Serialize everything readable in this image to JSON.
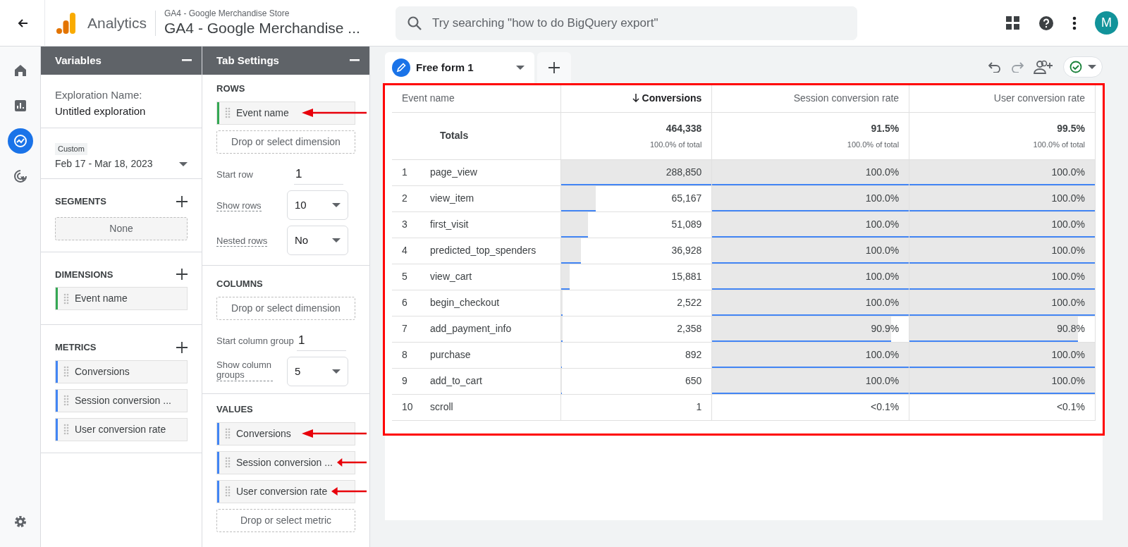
{
  "header": {
    "app_name": "Analytics",
    "account": "GA4 - Google Merchandise Store",
    "property": "GA4 - Google Merchandise ...",
    "search": {
      "placeholder": "Try searching \"how to do BigQuery export\""
    },
    "avatar": "M"
  },
  "nav_rail": [
    {
      "kind": "home",
      "selected": false
    },
    {
      "kind": "reports",
      "selected": false
    },
    {
      "kind": "explore",
      "selected": true
    },
    {
      "kind": "advertising",
      "selected": false
    },
    {
      "kind": "settings",
      "selected": false
    }
  ],
  "variables": {
    "title": "Variables",
    "exploration_label": "Exploration Name:",
    "exploration_name": "Untitled exploration",
    "date_tag": "Custom",
    "date_range": "Feb 17 - Mar 18, 2023",
    "segments": {
      "title": "SEGMENTS",
      "empty": "None"
    },
    "dimensions": {
      "title": "DIMENSIONS",
      "items": [
        {
          "label": "Event name",
          "color": "#34a853"
        }
      ]
    },
    "metrics": {
      "title": "METRICS",
      "items": [
        {
          "label": "Conversions",
          "color": "#4285f4"
        },
        {
          "label": "Session conversion ...",
          "color": "#4285f4"
        },
        {
          "label": "User conversion rate",
          "color": "#4285f4"
        }
      ]
    }
  },
  "tab_settings": {
    "title": "Tab Settings",
    "rows": {
      "title": "ROWS",
      "items": [
        {
          "label": "Event name",
          "color": "#34a853",
          "annotated": true
        }
      ],
      "drop": "Drop or select dimension",
      "start_row_label": "Start row",
      "start_row": "1",
      "show_rows_label": "Show rows",
      "show_rows": "10",
      "nested_rows_label": "Nested rows",
      "nested_rows": "No"
    },
    "columns": {
      "title": "COLUMNS",
      "drop": "Drop or select dimension",
      "start_label": "Start column group",
      "start": "1",
      "show_label": "Show column groups",
      "show": "5"
    },
    "values": {
      "title": "VALUES",
      "items": [
        {
          "label": "Conversions",
          "color": "#4285f4",
          "annotated": true
        },
        {
          "label": "Session conversion ...",
          "color": "#4285f4",
          "annotated": true
        },
        {
          "label": "User conversion rate",
          "color": "#4285f4",
          "annotated": true
        }
      ],
      "drop": "Drop or select metric"
    }
  },
  "tabs": [
    {
      "label": "Free form 1",
      "selected": true
    }
  ],
  "table": {
    "highlighted": true,
    "columns": [
      {
        "label": "Event name",
        "sorted": false
      },
      {
        "label": "Conversions",
        "sorted": true
      },
      {
        "label": "Session conversion rate",
        "sorted": false
      },
      {
        "label": "User conversion rate",
        "sorted": false
      }
    ],
    "totals": [
      {
        "value": "Totals"
      },
      {
        "value": "464,338",
        "share": "100.0% of total"
      },
      {
        "value": "91.5%",
        "share": "100.0% of total"
      },
      {
        "value": "99.5%",
        "share": "100.0% of total"
      }
    ],
    "rows": [
      {
        "cells": [
          {
            "index": "1",
            "value": "page_view"
          },
          {
            "value": "288,850",
            "level": 1
          },
          {
            "value": "100.0%",
            "level": 1
          },
          {
            "value": "100.0%",
            "level": 1
          }
        ]
      },
      {
        "cells": [
          {
            "index": "2",
            "value": "view_item"
          },
          {
            "value": "65,167",
            "level": 0.226
          },
          {
            "value": "100.0%",
            "level": 1
          },
          {
            "value": "100.0%",
            "level": 1
          }
        ]
      },
      {
        "cells": [
          {
            "index": "3",
            "value": "first_visit"
          },
          {
            "value": "51,089",
            "level": 0.177
          },
          {
            "value": "100.0%",
            "level": 1
          },
          {
            "value": "100.0%",
            "level": 1
          }
        ]
      },
      {
        "cells": [
          {
            "index": "4",
            "value": "predicted_top_spenders"
          },
          {
            "value": "36,928",
            "level": 0.128
          },
          {
            "value": "100.0%",
            "level": 1
          },
          {
            "value": "100.0%",
            "level": 1
          }
        ]
      },
      {
        "cells": [
          {
            "index": "5",
            "value": "view_cart"
          },
          {
            "value": "15,881",
            "level": 0.055
          },
          {
            "value": "100.0%",
            "level": 1
          },
          {
            "value": "100.0%",
            "level": 1
          }
        ]
      },
      {
        "cells": [
          {
            "index": "6",
            "value": "begin_checkout"
          },
          {
            "value": "2,522",
            "level": 0.009
          },
          {
            "value": "100.0%",
            "level": 1
          },
          {
            "value": "100.0%",
            "level": 1
          }
        ]
      },
      {
        "cells": [
          {
            "index": "7",
            "value": "add_payment_info"
          },
          {
            "value": "2,358",
            "level": 0.008
          },
          {
            "value": "90.9%",
            "level": 0.909
          },
          {
            "value": "90.8%",
            "level": 0.908
          }
        ]
      },
      {
        "cells": [
          {
            "index": "8",
            "value": "purchase"
          },
          {
            "value": "892",
            "level": 0.003
          },
          {
            "value": "100.0%",
            "level": 1
          },
          {
            "value": "100.0%",
            "level": 1
          }
        ]
      },
      {
        "cells": [
          {
            "index": "9",
            "value": "add_to_cart"
          },
          {
            "value": "650",
            "level": 0.002
          },
          {
            "value": "100.0%",
            "level": 1
          },
          {
            "value": "100.0%",
            "level": 1
          }
        ]
      },
      {
        "cells": [
          {
            "index": "10",
            "value": "scroll"
          },
          {
            "value": "1"
          },
          {
            "value": "<0.1%"
          },
          {
            "value": "<0.1%"
          }
        ]
      }
    ]
  }
}
